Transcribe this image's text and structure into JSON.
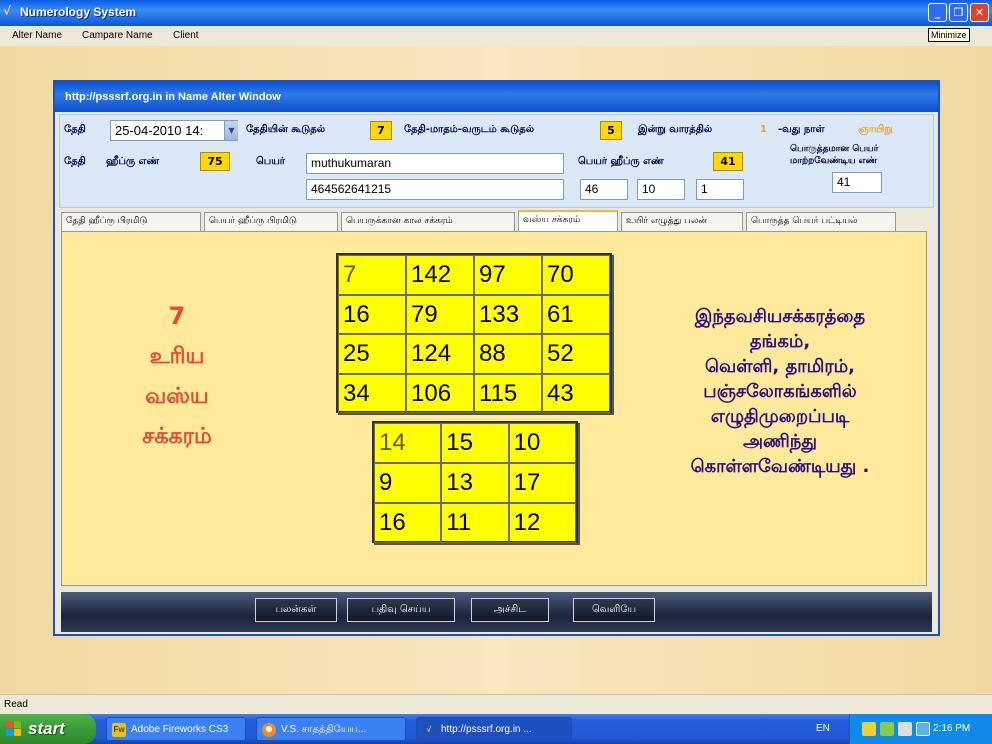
{
  "window": {
    "title": "Numerology System"
  },
  "menu": [
    "Alter Name",
    "Campare Name",
    "Client"
  ],
  "tooltip": "Minimize",
  "inner": {
    "title": "http://psssrf.org.in   in  Name Alter Window"
  },
  "form": {
    "date_label": "தேதி",
    "date_value": "25-04-2010 14:",
    "date_sum_label": "தேதியின் கூடுதல்",
    "date_sum": "7",
    "dmy_sum_label": "தேதி-மாதம்-வருடம் கூடுதல்",
    "dmy_sum": "5",
    "weekday_prefix": "இன்று வாரத்தில்",
    "weekday_num": "1",
    "weekday_suffix": "-வது நாள்",
    "weekday_name": "ஞாயிறு",
    "date_label2": "தேதி",
    "hebrew_label": "ஹீப்ரு எண்",
    "hebrew_num": "75",
    "name_label": "பெயர்",
    "name_value": "muthukumaran",
    "name_digits": "464562641215",
    "name_hebrew_label": "பெயர் ஹீப்ரு எண்",
    "name_hebrew_num": "41",
    "num_a": "46",
    "num_b": "10",
    "num_c": "1",
    "match_label_1": "பொருத்தமான பெயர்",
    "match_label_2": "மாற்றவேண்டிய எண்",
    "match_value": "41"
  },
  "tabs": [
    "தேதி ஹீப்ரு பிரமிடு",
    "பெயர் ஹீப்ரு பிரமிடு",
    "பெயருக்கான கால  சக்கரம்",
    "வஸ்ய சக்கரம்",
    "உயிர் எழுத்து பலன்",
    "பொருத்த பெயர் பட்டியல்"
  ],
  "active_tab": 3,
  "panel": {
    "left_number": "7",
    "left_lines": [
      "உரிய",
      "வஸ்ய",
      "சக்கரம்"
    ],
    "right_lines": [
      "இந்தவசியசக்கரத்தை",
      "தங்கம்,",
      "வெள்ளி, தாமிரம்,",
      "பஞ்சலோகங்களில்",
      "எழுதிமுறைப்படி",
      "அணிந்து",
      "கொள்ளவேண்டியது ."
    ],
    "grid_4x4": [
      [
        "7",
        "142",
        "97",
        "70"
      ],
      [
        "16",
        "79",
        "133",
        "61"
      ],
      [
        "25",
        "124",
        "88",
        "52"
      ],
      [
        "34",
        "106",
        "115",
        "43"
      ]
    ],
    "grid_3x3": [
      [
        "14",
        "15",
        "10"
      ],
      [
        "9",
        "13",
        "17"
      ],
      [
        "16",
        "11",
        "12"
      ]
    ]
  },
  "buttons": [
    "பலன்கள்",
    "பதிவு செய்ய",
    "அச்சிட",
    "வெளியே"
  ],
  "status": "Read",
  "taskbar": {
    "start": "start",
    "tasks": [
      "Adobe Fireworks CS3",
      "V.S. சாதத்தியேய...",
      "http://psssrf.org.in  ..."
    ],
    "lang": "EN",
    "clock": "2:16 PM"
  }
}
